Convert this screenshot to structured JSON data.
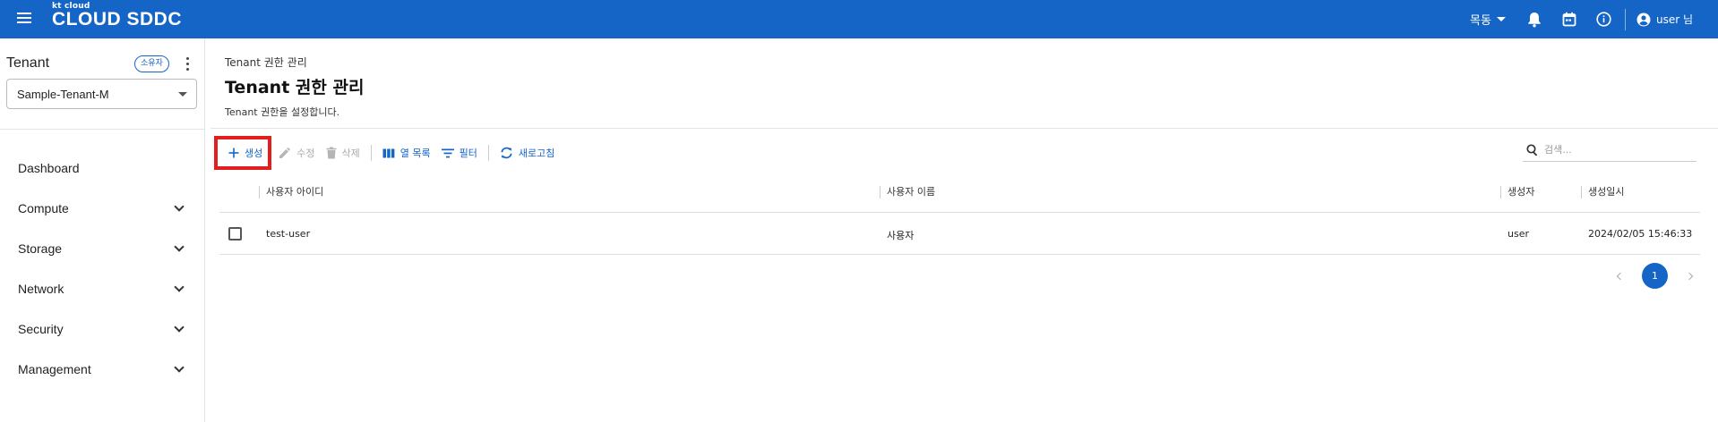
{
  "header": {
    "logo_small": "kt cloud",
    "logo_big": "CLOUD SDDC",
    "region": "목동",
    "user": "user 님"
  },
  "sidebar": {
    "title": "Tenant",
    "owner_badge": "소유자",
    "tenant_selected": "Sample-Tenant-M",
    "items": [
      {
        "label": "Dashboard",
        "expandable": false
      },
      {
        "label": "Compute",
        "expandable": true
      },
      {
        "label": "Storage",
        "expandable": true
      },
      {
        "label": "Network",
        "expandable": true
      },
      {
        "label": "Security",
        "expandable": true
      },
      {
        "label": "Management",
        "expandable": true
      }
    ]
  },
  "main": {
    "breadcrumb": "Tenant 권한 관리",
    "title": "Tenant 권한 관리",
    "description": "Tenant 권한을 설정합니다.",
    "toolbar": {
      "create": "생성",
      "edit": "수정",
      "delete": "삭제",
      "columns": "열 목록",
      "filter": "필터",
      "refresh": "새로고침"
    },
    "search_placeholder": "검색...",
    "table": {
      "columns": [
        "사용자 아이디",
        "사용자 이름",
        "생성자",
        "생성일시"
      ],
      "rows": [
        [
          "test-user",
          "사용자",
          "user",
          "2024/02/05 15:46:33"
        ]
      ]
    },
    "pagination": {
      "current": "1"
    }
  },
  "colors": {
    "primary": "#1565c7",
    "highlight": "#e41d1d"
  }
}
